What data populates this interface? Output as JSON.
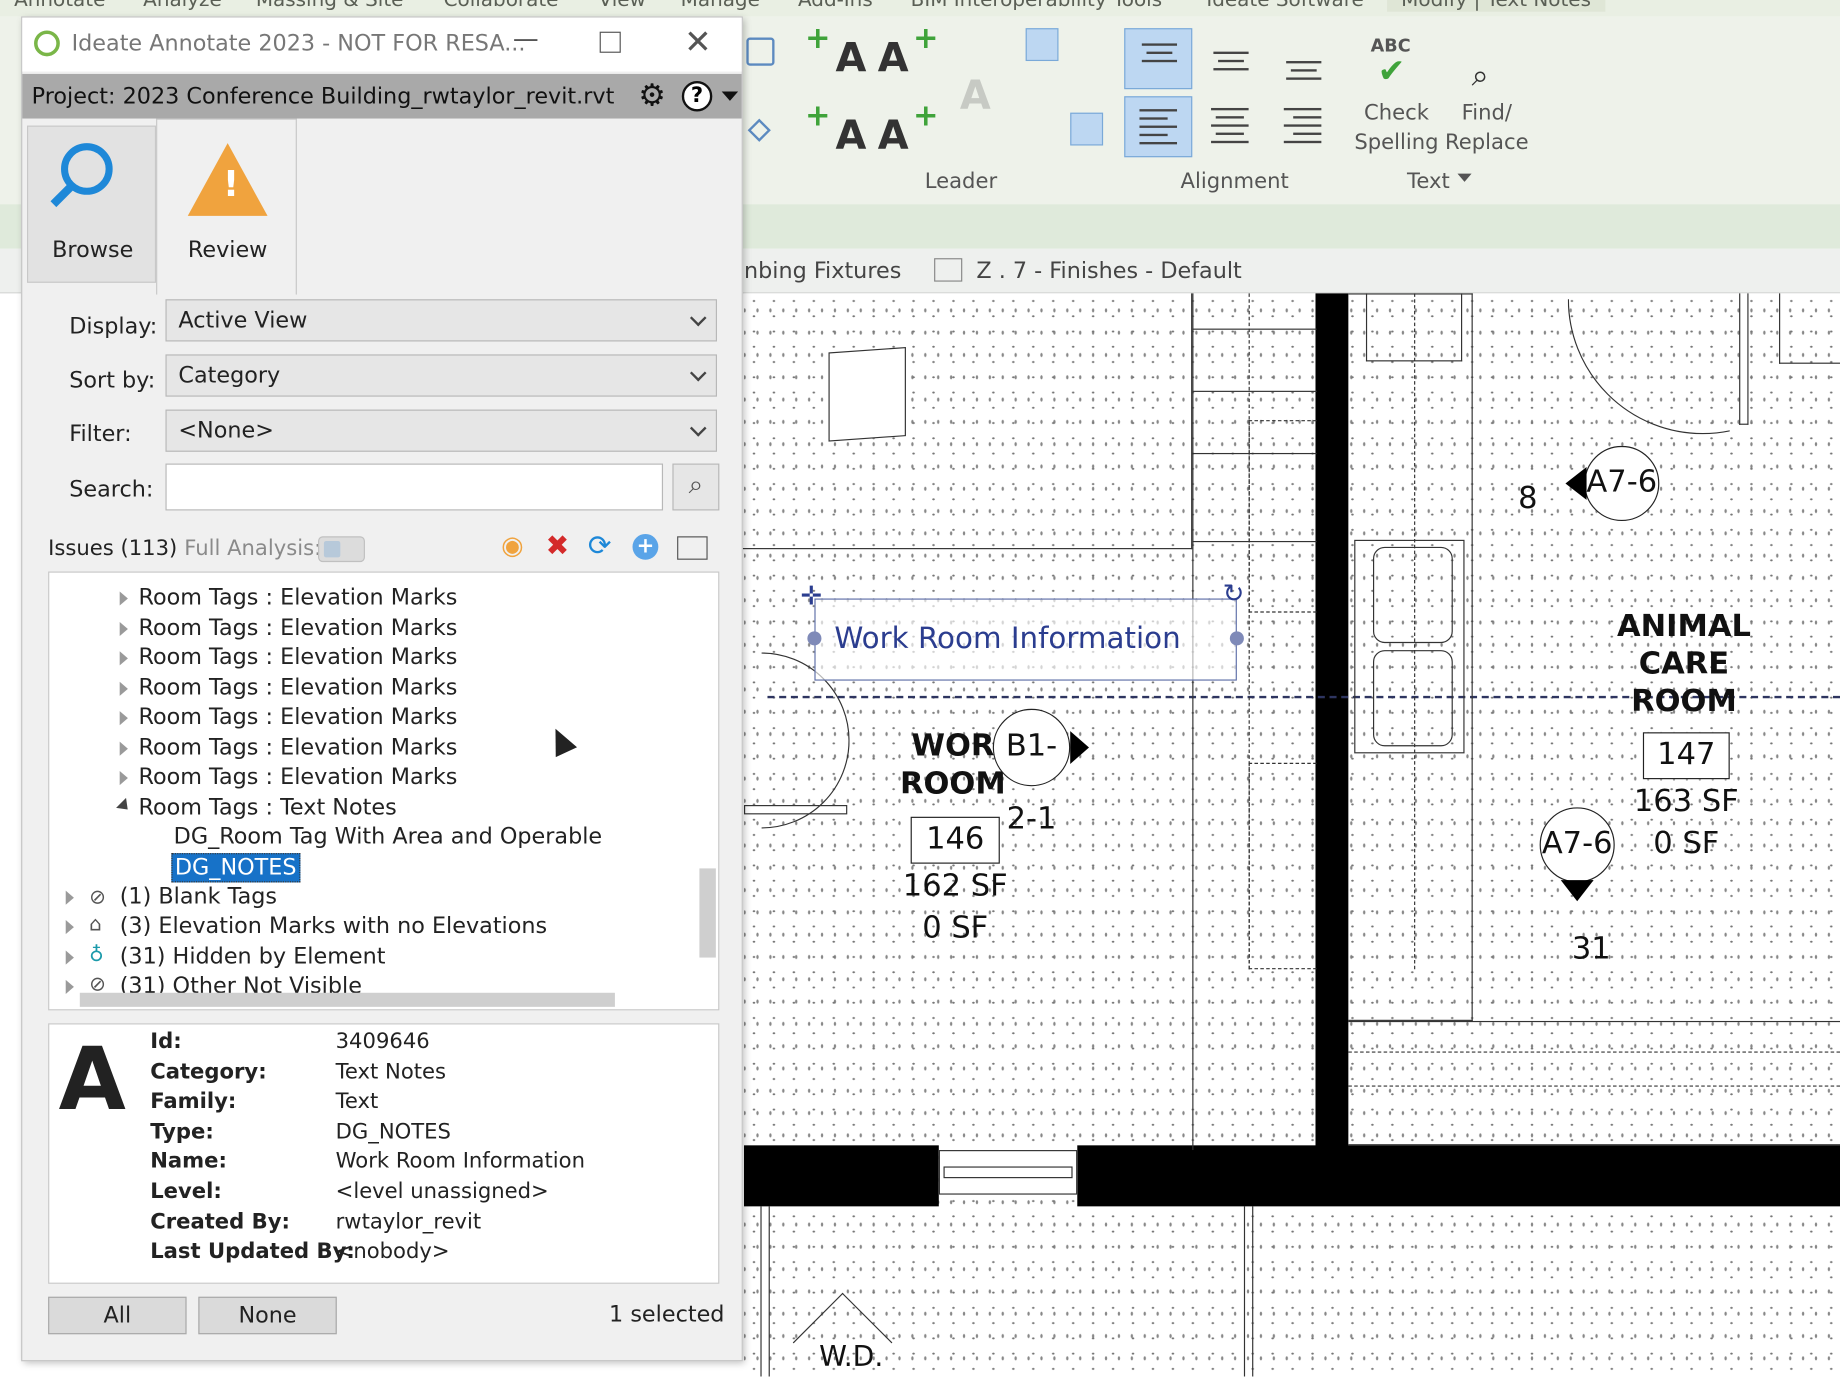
{
  "ribbon": {
    "menu_tabs": [
      "Annotate",
      "Analyze",
      "Massing & Site",
      "Collaborate",
      "View",
      "Manage",
      "Add-Ins",
      "BIM Interoperability Tools",
      "Ideate Software",
      "Modify | Text Notes"
    ],
    "groups": {
      "leader": "Leader",
      "alignment": "Alignment",
      "text": "Text"
    },
    "check_spelling": [
      "Check",
      "Spelling"
    ],
    "find_replace": [
      "Find/",
      "Replace"
    ],
    "abc_label": "ABC",
    "big_a": "A"
  },
  "view_tabs": {
    "left": "nbing Fixtures",
    "right": "Z . 7 - Finishes - Default"
  },
  "panel": {
    "title": "Ideate Annotate 2023 - NOT FOR RESA...",
    "project": "Project: 2023 Conference Building_rwtaylor_revit.rvt",
    "tabs": {
      "browse": "Browse",
      "review": "Review"
    },
    "display": {
      "label": "Display:",
      "value": "Active View"
    },
    "sort_by": {
      "label": "Sort by:",
      "value": "Category"
    },
    "filter": {
      "label": "Filter:",
      "value": "<None>"
    },
    "search": {
      "label": "Search:",
      "value": ""
    },
    "issues_label": "Issues (113)",
    "full_analysis_label": "Full Analysis:",
    "tree": {
      "elevation_rows": [
        "Room Tags : Elevation Marks",
        "Room Tags : Elevation Marks",
        "Room Tags : Elevation Marks",
        "Room Tags : Elevation Marks",
        "Room Tags : Elevation Marks",
        "Room Tags : Elevation Marks",
        "Room Tags : Elevation Marks"
      ],
      "text_notes": "Room Tags : Text Notes",
      "child1": "DG_Room Tag With Area and Operable",
      "child2": "DG_NOTES",
      "blank_tags": "(1) Blank Tags",
      "elevation_no": "(3) Elevation Marks with no Elevations",
      "hidden": "(31) Hidden by Element",
      "other": "(31) Other Not Visible"
    },
    "details": {
      "glyph": "A",
      "id": {
        "k": "Id:",
        "v": "3409646"
      },
      "category": {
        "k": "Category:",
        "v": "Text Notes"
      },
      "family": {
        "k": "Family:",
        "v": "Text"
      },
      "type": {
        "k": "Type:",
        "v": "DG_NOTES"
      },
      "name": {
        "k": "Name:",
        "v": "Work Room Information"
      },
      "level": {
        "k": "Level:",
        "v": "<level unassigned>"
      },
      "created": {
        "k": "Created By:",
        "v": "rwtaylor_revit"
      },
      "updated": {
        "k": "Last Updated By:",
        "v": "<nobody>"
      }
    },
    "btn_all": "All",
    "btn_none": "None",
    "selected": "1 selected"
  },
  "drawing": {
    "text_note": "Work Room Information",
    "work_room": [
      "WOR",
      "ROOM"
    ],
    "work_num": "146",
    "work_area": "162 SF",
    "work_area2": "0 SF",
    "tag_b": "B1-2-1",
    "animal": [
      "ANIMAL",
      "CARE",
      "ROOM"
    ],
    "animal_num": "147",
    "animal_area": "163 SF",
    "animal_area2": "0 SF",
    "tag_a7_top": "A7-6",
    "tag_a7": "A7-6",
    "num_8": "8",
    "num_31": "31",
    "wd": "W.D."
  }
}
